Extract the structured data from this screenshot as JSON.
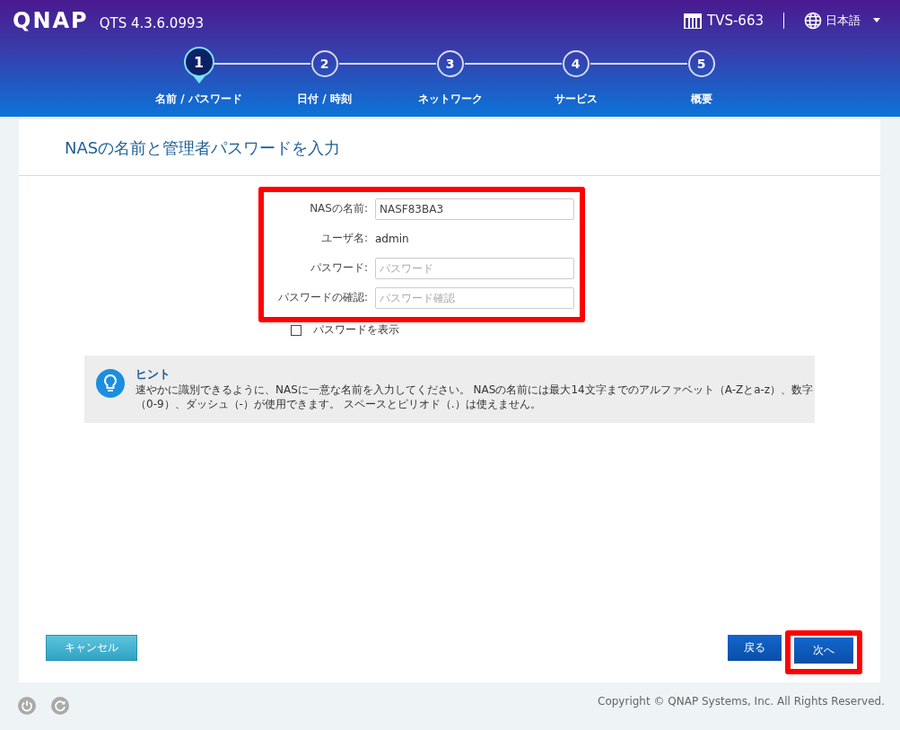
{
  "header": {
    "logo": "QNAP",
    "version": "QTS 4.3.6.0993",
    "device": "TVS-663",
    "language": "日本語"
  },
  "steps": [
    {
      "number": "1",
      "label": "名前 / パスワード",
      "selected": true
    },
    {
      "number": "2",
      "label": "日付 / 時刻",
      "selected": false
    },
    {
      "number": "3",
      "label": "ネットワーク",
      "selected": false
    },
    {
      "number": "4",
      "label": "サービス",
      "selected": false
    },
    {
      "number": "5",
      "label": "概要",
      "selected": false
    }
  ],
  "panel": {
    "title": "NASの名前と管理者パスワードを入力"
  },
  "form": {
    "fields": [
      {
        "kind": "input",
        "label": "NASの名前:",
        "value": "NASF83BA3"
      },
      {
        "kind": "text",
        "label": "ユーザ名:",
        "value": "admin"
      },
      {
        "kind": "input",
        "label": "パスワード:",
        "placeholder": "パスワード"
      },
      {
        "kind": "input",
        "label": "パスワードの確認:",
        "placeholder": "パスワード確認"
      }
    ],
    "show_password": {
      "label": "パスワードを表示",
      "checked": false
    }
  },
  "hint": {
    "title": "ヒント",
    "text": "速やかに識別できるように、NASに一意な名前を入力してください。 NASの名前には最大14文字までのアルファベット（A-Zとa-z）、数字（0-9）、ダッシュ（-）が使用できます。 スペースとピリオド（.）は使えません。"
  },
  "buttons": {
    "cancel": "キャンセル",
    "back": "戻る",
    "next": "次へ"
  },
  "footer": {
    "copyright": "Copyright © QNAP Systems, Inc. All Rights Reserved."
  }
}
